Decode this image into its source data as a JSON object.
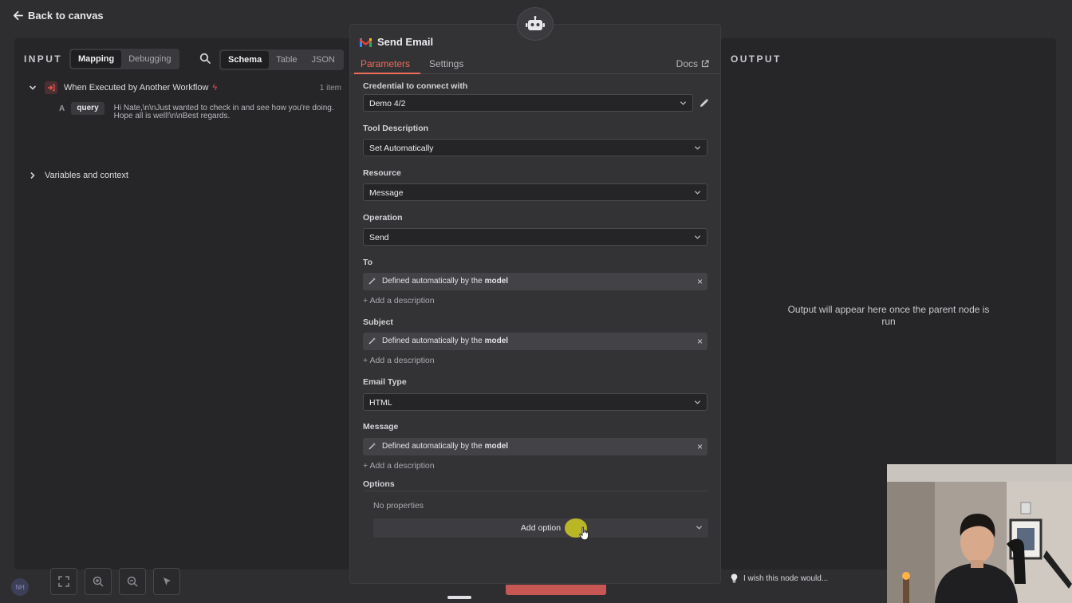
{
  "topbar": {
    "back_label": "Back to canvas"
  },
  "input_panel": {
    "title": "INPUT",
    "mode_options": [
      "Mapping",
      "Debugging"
    ],
    "active_mode": "Mapping",
    "view_options": [
      "Schema",
      "Table",
      "JSON"
    ],
    "active_view": "Schema",
    "trigger": {
      "label": "When Executed by Another Workflow",
      "count": "1 item"
    },
    "query": {
      "type": "A",
      "key": "query",
      "value": "Hi Nate,\\n\\nJust wanted to check in and see how you're doing. Hope all is well!\\n\\nBest regards."
    },
    "vars_label": "Variables and context"
  },
  "node": {
    "title": "Send Email",
    "tabs": [
      "Parameters",
      "Settings"
    ],
    "active_tab": "Parameters",
    "docs_label": "Docs",
    "credential": {
      "label": "Credential to connect with",
      "value": "Demo 4/2"
    },
    "tool_description": {
      "label": "Tool Description",
      "value": "Set Automatically"
    },
    "resource": {
      "label": "Resource",
      "value": "Message"
    },
    "operation": {
      "label": "Operation",
      "value": "Send"
    },
    "to": {
      "label": "To",
      "auto_text": "Defined automatically by the",
      "auto_bold": "model",
      "add_desc": "+ Add a description"
    },
    "subject": {
      "label": "Subject",
      "auto_text": "Defined automatically by the",
      "auto_bold": "model",
      "add_desc": "+ Add a description"
    },
    "email_type": {
      "label": "Email Type",
      "value": "HTML"
    },
    "message": {
      "label": "Message",
      "auto_text": "Defined automatically by the",
      "auto_bold": "model",
      "add_desc": "+ Add a description"
    },
    "options": {
      "label": "Options",
      "empty_text": "No properties",
      "add_label": "Add option"
    },
    "close_symbol": "×"
  },
  "output_panel": {
    "title": "OUTPUT",
    "message": "Output will appear here once the parent node is run"
  },
  "footer": {
    "avatar_initials": "NH",
    "feedback_label": "I wish this node would..."
  },
  "colors": {
    "accent": "#f06a5a",
    "trigger_bolt": "#e9544e",
    "cursor_highlight": "#d6d222"
  }
}
